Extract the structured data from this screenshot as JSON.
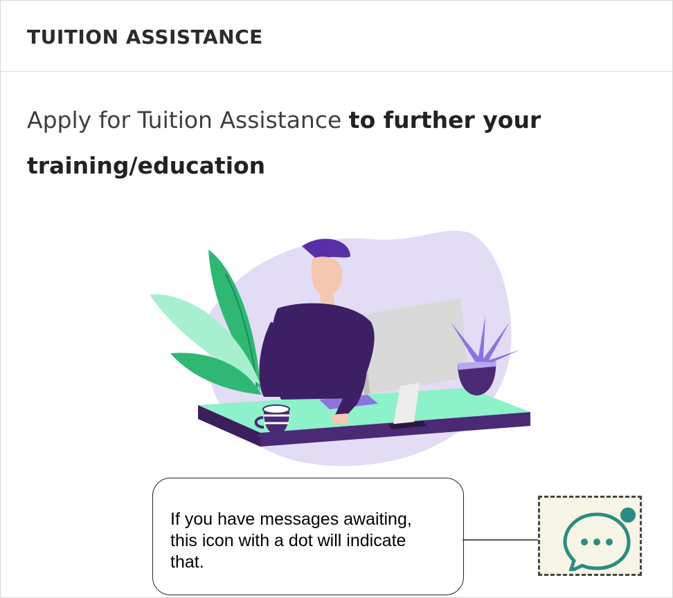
{
  "card": {
    "title": "TUITION ASSISTANCE",
    "tagline_regular": "Apply for Tuition Assistance ",
    "tagline_bold": "to further your training/education"
  },
  "illustration": {
    "icon": "person-at-desk-illustration"
  },
  "callout": {
    "text": "If you have messages awaiting, this icon with a dot will indicate that."
  },
  "chat_indicator": {
    "icon": "chat-bubble-icon",
    "has_unread_dot": true,
    "colors": {
      "icon": "#2a8c82",
      "dot": "#2a8c82",
      "background": "#f7f5e6"
    }
  }
}
